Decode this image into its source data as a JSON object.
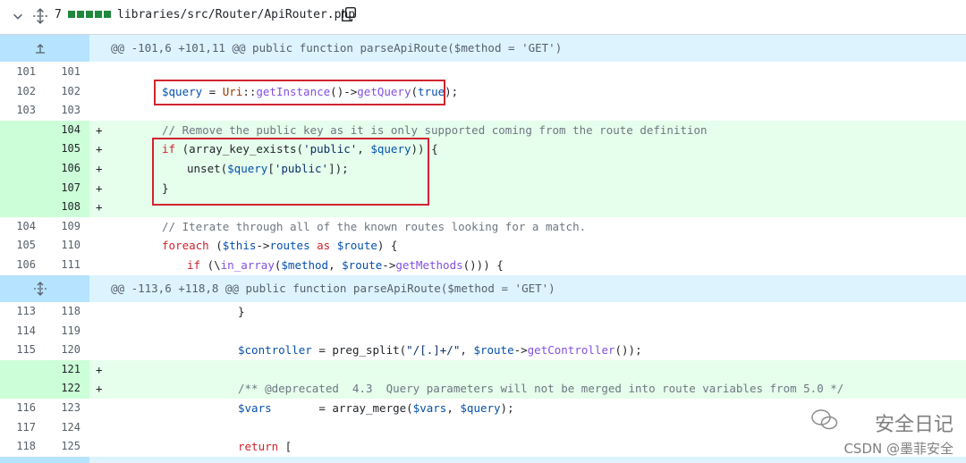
{
  "file_header": {
    "changes_count": "7",
    "path": "libraries/src/Router/ApiRouter.php"
  },
  "hunks": [
    "@@ -101,6 +101,11 @@ public function parseApiRoute($method = 'GET')",
    "@@ -113,6 +118,8 @@ public function parseApiRoute($method = 'GET')"
  ],
  "lines": [
    {
      "old": "101",
      "new": "101",
      "sign": ""
    },
    {
      "old": "102",
      "new": "102",
      "sign": ""
    },
    {
      "old": "103",
      "new": "103",
      "sign": ""
    },
    {
      "old": "",
      "new": "104",
      "sign": "+"
    },
    {
      "old": "",
      "new": "105",
      "sign": "+"
    },
    {
      "old": "",
      "new": "106",
      "sign": "+"
    },
    {
      "old": "",
      "new": "107",
      "sign": "+"
    },
    {
      "old": "",
      "new": "108",
      "sign": "+"
    },
    {
      "old": "104",
      "new": "109",
      "sign": ""
    },
    {
      "old": "105",
      "new": "110",
      "sign": ""
    },
    {
      "old": "106",
      "new": "111",
      "sign": ""
    },
    {
      "old": "113",
      "new": "118",
      "sign": ""
    },
    {
      "old": "114",
      "new": "119",
      "sign": ""
    },
    {
      "old": "115",
      "new": "120",
      "sign": ""
    },
    {
      "old": "",
      "new": "121",
      "sign": "+"
    },
    {
      "old": "",
      "new": "122",
      "sign": "+"
    },
    {
      "old": "116",
      "new": "123",
      "sign": ""
    },
    {
      "old": "117",
      "new": "124",
      "sign": ""
    },
    {
      "old": "118",
      "new": "125",
      "sign": ""
    }
  ],
  "code": {
    "l102_var": "$query",
    "l102_eq": " = ",
    "l102_cls": "Uri",
    "l102_sep1": "::",
    "l102_fn1": "getInstance",
    "l102_p1": "()->",
    "l102_fn2": "getQuery",
    "l102_p2": "(",
    "l102_true": "true",
    "l102_end": ");",
    "l104": "// Remove the public key as it is only supported coming from the route definition",
    "l105_if": "if",
    "l105_a": " (array_key_exists(",
    "l105_str": "'public'",
    "l105_b": ", ",
    "l105_var": "$query",
    "l105_c": ")) {",
    "l106_a": "unset(",
    "l106_var": "$query",
    "l106_b": "[",
    "l106_str": "'public'",
    "l106_c": "]);",
    "l107": "}",
    "l109": "// Iterate through all of the known routes looking for a match.",
    "l110_kw": "foreach",
    "l110_a": " (",
    "l110_this": "$this",
    "l110_b": "->",
    "l110_routes": "routes",
    "l110_as": " as ",
    "l110_var": "$route",
    "l110_c": ") {",
    "l111_if": "if",
    "l111_a": " (\\",
    "l111_fn": "in_array",
    "l111_b": "(",
    "l111_v1": "$method",
    "l111_c": ", ",
    "l111_v2": "$route",
    "l111_d": "->",
    "l111_fn2": "getMethods",
    "l111_e": "())) {",
    "l118": "}",
    "l120_var": "$controller",
    "l120_a": " = preg_split(",
    "l120_str": "\"/[.]+/\"",
    "l120_b": ", ",
    "l120_v2": "$route",
    "l120_c": "->",
    "l120_fn": "getController",
    "l120_d": "());",
    "l122": "/** @deprecated  4.3  Query parameters will not be merged into route variables from 5.0 */",
    "l123_var": "$vars",
    "l123_a": "       = array_merge(",
    "l123_v2": "$vars",
    "l123_b": ", ",
    "l123_v3": "$query",
    "l123_c": ");",
    "l125_kw": "return",
    "l125_a": " ["
  },
  "watermark": {
    "line1": "安全日记",
    "line2": "CSDN @墨菲安全"
  },
  "colors": {
    "added_bg": "#e6ffec",
    "added_gutter": "#ccffd8",
    "hunk_bg": "#ddf4ff",
    "highlight_box": "#d1242f"
  }
}
